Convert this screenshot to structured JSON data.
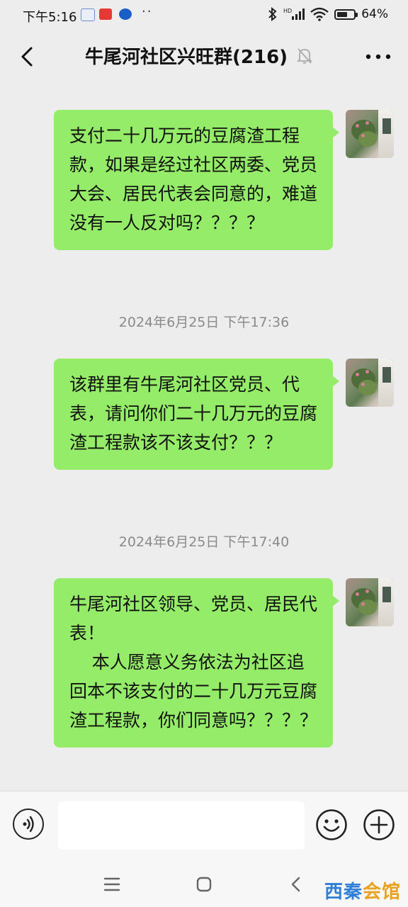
{
  "status_bar": {
    "time": "下午5:16",
    "battery_percent": "64%",
    "battery_level": 0.64,
    "notification_icons": [
      "app-icon-1",
      "toutiao-icon",
      "app-icon-3"
    ],
    "overflow": "··"
  },
  "header": {
    "title": "牛尾河社区兴旺群(216)",
    "muted": true
  },
  "messages": [
    {
      "text": "支付二十几万元的豆腐渣工程款，如果是经过社区两委、党员大会、居民代表会同意的，难道没有一人反对吗？？？？"
    },
    {
      "timestamp": "2024年6月25日 下午17:36",
      "text": "该群里有牛尾河社区党员、代表，请问你们二十几万元的豆腐渣工程款该不该支付？？？"
    },
    {
      "timestamp": "2024年6月25日 下午17:40",
      "text": "牛尾河社区领导、党员、居民代表！\n    本人愿意义务依法为社区追回本不该支付的二十几万元豆腐渣工程款，你们同意吗？？？？"
    }
  ],
  "input_bar": {
    "text_value": ""
  },
  "watermark": {
    "part1": "西秦",
    "part2": "会馆"
  },
  "colors": {
    "bubble": "#95ec69",
    "background": "#ededed",
    "timestamp": "#8a8a8a"
  }
}
